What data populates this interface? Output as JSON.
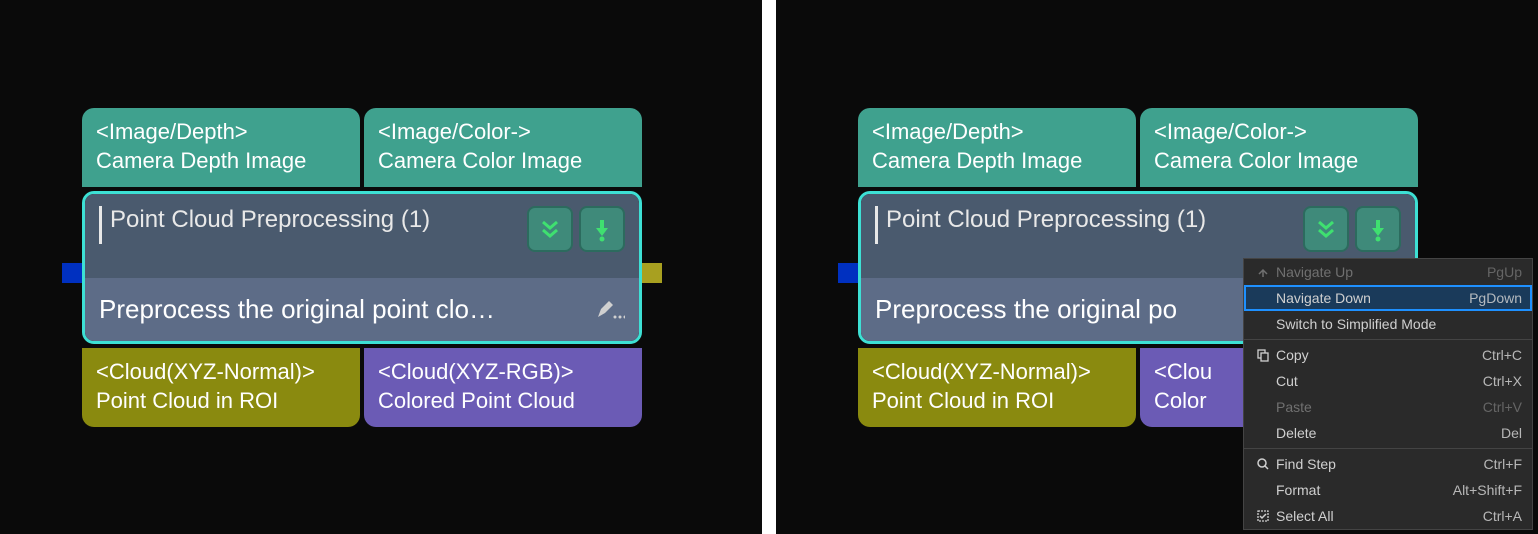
{
  "left": {
    "inputs": [
      {
        "type": "<Image/Depth>",
        "name": "Camera Depth Image"
      },
      {
        "type": "<Image/Color->",
        "name": "Camera Color Image"
      }
    ],
    "node": {
      "title": "Point Cloud Preprocessing (1)",
      "description": "Preprocess the original point clo…"
    },
    "outputs": [
      {
        "type": "<Cloud(XYZ-Normal)>",
        "name": "Point Cloud in ROI"
      },
      {
        "type": "<Cloud(XYZ-RGB)>",
        "name": "Colored Point Cloud"
      }
    ]
  },
  "right": {
    "inputs": [
      {
        "type": "<Image/Depth>",
        "name": "Camera Depth Image"
      },
      {
        "type": "<Image/Color->",
        "name": "Camera Color Image"
      }
    ],
    "node": {
      "title": "Point Cloud Preprocessing (1)",
      "description": "Preprocess the original po"
    },
    "outputs": [
      {
        "type": "<Cloud(XYZ-Normal)>",
        "name": "Point Cloud in ROI"
      },
      {
        "type": "<Clou",
        "name": "Color"
      }
    ]
  },
  "menu": {
    "items": [
      {
        "icon": "nav-up-icon",
        "label": "Navigate Up",
        "shortcut": "PgUp",
        "disabled": true
      },
      {
        "icon": "",
        "label": "Navigate Down",
        "shortcut": "PgDown",
        "highlighted": true
      },
      {
        "icon": "",
        "label": "Switch to Simplified Mode",
        "shortcut": ""
      },
      {
        "sep": true
      },
      {
        "icon": "copy-icon",
        "label": "Copy",
        "shortcut": "Ctrl+C"
      },
      {
        "icon": "",
        "label": "Cut",
        "shortcut": "Ctrl+X"
      },
      {
        "icon": "",
        "label": "Paste",
        "shortcut": "Ctrl+V",
        "disabled": true
      },
      {
        "icon": "",
        "label": "Delete",
        "shortcut": "Del"
      },
      {
        "sep": true
      },
      {
        "icon": "search-icon",
        "label": "Find Step",
        "shortcut": "Ctrl+F"
      },
      {
        "icon": "",
        "label": "Format",
        "shortcut": "Alt+Shift+F"
      },
      {
        "icon": "select-all-icon",
        "label": "Select All",
        "shortcut": "Ctrl+A"
      }
    ]
  }
}
